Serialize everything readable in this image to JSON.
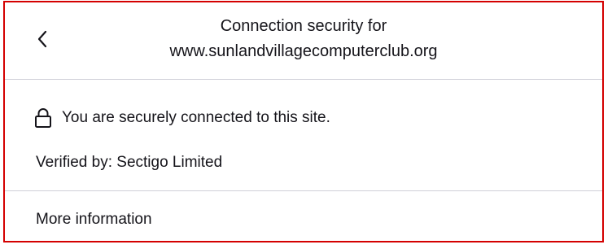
{
  "header": {
    "back_icon": "chevron-left-icon",
    "title_line1": "Connection security for",
    "title_line2": "www.sunlandvillagecomputerclub.org"
  },
  "security": {
    "icon": "lock-icon",
    "status": "You are securely connected to this site.",
    "verified_by": "Verified by: Sectigo Limited"
  },
  "footer": {
    "more_info_label": "More information"
  },
  "colors": {
    "frame_border": "#d40000",
    "divider": "#cfcfd8",
    "text": "#15141a"
  }
}
